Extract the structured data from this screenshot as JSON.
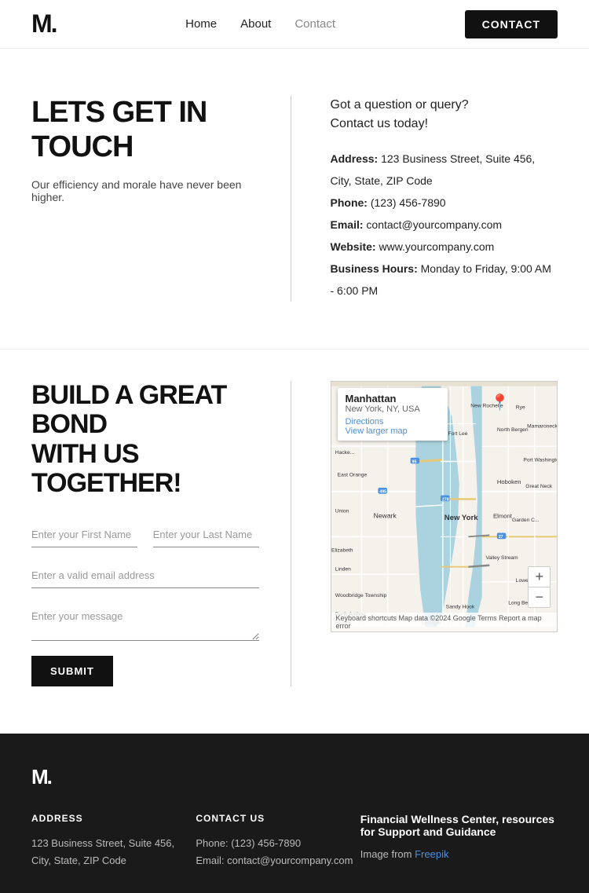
{
  "nav": {
    "logo": "M.",
    "links": [
      {
        "id": "home",
        "label": "Home",
        "active": false
      },
      {
        "id": "about",
        "label": "About",
        "active": false
      },
      {
        "id": "contact",
        "label": "Contact",
        "active": true
      }
    ],
    "contact_button": "CONTACT"
  },
  "hero": {
    "heading": "LETS GET IN TOUCH",
    "subheading": "Our efficiency and morale have never been higher.",
    "intro_line1": "Got a question or query?",
    "intro_line2": "Contact us today!",
    "address_label": "Address:",
    "address_value": "123 Business Street, Suite 456, City, State, ZIP Code",
    "phone_label": "Phone:",
    "phone_value": "(123) 456-7890",
    "email_label": "Email:",
    "email_value": "contact@yourcompany.com",
    "website_label": "Website:",
    "website_value": "www.yourcompany.com",
    "hours_label": "Business Hours:",
    "hours_value": "Monday to Friday, 9:00 AM - 6:00 PM"
  },
  "form_section": {
    "heading_line1": "BUILD A GREAT BOND",
    "heading_line2": "WITH US TOGETHER!",
    "firstname_placeholder": "Enter your First Name",
    "lastname_placeholder": "Enter your Last Name",
    "email_placeholder": "Enter a valid email address",
    "message_placeholder": "Enter your message",
    "submit_label": "SUBMIT"
  },
  "map": {
    "title": "Manhattan",
    "subtitle": "New York, NY, USA",
    "directions_label": "Directions",
    "larger_label": "View larger map",
    "zoom_in": "+",
    "zoom_out": "−",
    "attribution": "Keyboard shortcuts   Map data ©2024 Google   Terms   Report a map error"
  },
  "footer": {
    "logo": "M.",
    "address_heading": "ADDRESS",
    "address_text": "123 Business Street, Suite 456, City, State, ZIP Code",
    "contact_heading": "CONTACT US",
    "phone_label": "Phone:",
    "phone_value": "(123) 456-7890",
    "email_label": "Email:",
    "email_value": "contact@yourcompany.com",
    "resource_heading": "Financial Wellness Center, resources for Support and Guidance",
    "resource_text": "Image from ",
    "resource_link": "Freepik"
  }
}
